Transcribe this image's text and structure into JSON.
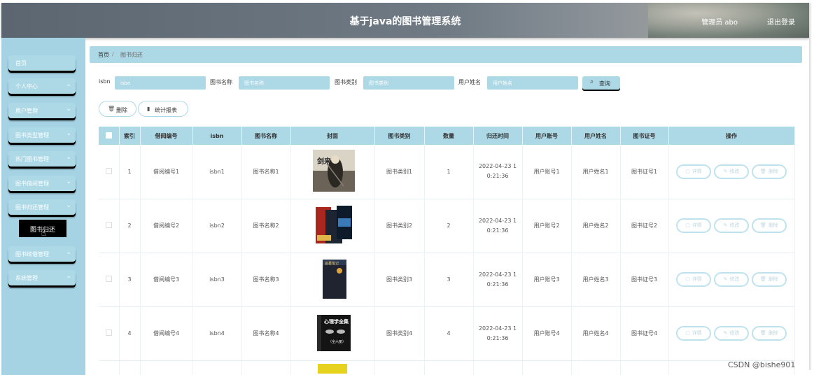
{
  "header": {
    "title": "基于java的图书管理系统",
    "admin_label": "管理员 abo",
    "logout": "退出登录"
  },
  "sidebar": {
    "items": [
      {
        "label": "首页",
        "has_chevron": false
      },
      {
        "label": "个人中心",
        "has_chevron": true
      },
      {
        "label": "用户管理",
        "has_chevron": true
      },
      {
        "label": "图书类型管理",
        "has_chevron": true
      },
      {
        "label": "热门图书管理",
        "has_chevron": true
      },
      {
        "label": "图书借阅管理",
        "has_chevron": true
      },
      {
        "label": "图书归还管理",
        "has_chevron": true
      },
      {
        "label": "图书续借管理",
        "has_chevron": true
      },
      {
        "label": "系统管理",
        "has_chevron": true
      }
    ],
    "open_submenu_item": "图书归还"
  },
  "breadcrumb": {
    "home": "首页",
    "separator": "/",
    "current": "图书归还"
  },
  "search": {
    "fields": [
      {
        "label": "isbn",
        "placeholder": "isbn"
      },
      {
        "label": "图书名称",
        "placeholder": "图书名称"
      },
      {
        "label": "图书类别",
        "placeholder": "图书类别"
      },
      {
        "label": "用户姓名",
        "placeholder": "用户姓名"
      }
    ],
    "button_label": "查询",
    "button_icon": "search-icon"
  },
  "actions": {
    "delete_label": "删除",
    "delete_icon": "trash-icon",
    "report_label": "统计报表",
    "report_icon": "bar-chart-icon"
  },
  "table": {
    "columns": [
      "",
      "索引",
      "借阅编号",
      "isbn",
      "图书名称",
      "封面",
      "图书类别",
      "数量",
      "归还时间",
      "用户账号",
      "用户姓名",
      "图书证号",
      "操作"
    ],
    "rows": [
      {
        "index": "1",
        "borrow_no": "借阅编号1",
        "isbn": "isbn1",
        "book_name": "图书名称1",
        "category": "图书类别1",
        "quantity": "1",
        "return_time_line1": "2022-04-23 1",
        "return_time_line2": "0:21:36",
        "account": "用户账号1",
        "user_name": "用户姓名1",
        "card_no": "图书证号1"
      },
      {
        "index": "2",
        "borrow_no": "借阅编号2",
        "isbn": "isbn2",
        "book_name": "图书名称2",
        "category": "图书类别2",
        "quantity": "2",
        "return_time_line1": "2022-04-23 1",
        "return_time_line2": "0:21:36",
        "account": "用户账号2",
        "user_name": "用户姓名2",
        "card_no": "图书证号2"
      },
      {
        "index": "3",
        "borrow_no": "借阅编号3",
        "isbn": "isbn3",
        "book_name": "图书名称3",
        "category": "图书类别3",
        "quantity": "3",
        "return_time_line1": "2022-04-23 1",
        "return_time_line2": "0:21:36",
        "account": "用户账号3",
        "user_name": "用户姓名3",
        "card_no": "图书证号3"
      },
      {
        "index": "4",
        "borrow_no": "借阅编号4",
        "isbn": "isbn4",
        "book_name": "图书名称4",
        "category": "图书类别4",
        "quantity": "4",
        "return_time_line1": "2022-04-23 1",
        "return_time_line2": "0:21:36",
        "account": "用户账号4",
        "user_name": "用户姓名4",
        "card_no": "图书证号4"
      }
    ],
    "row_actions": {
      "detail": "详情",
      "edit": "修改",
      "delete": "删除"
    }
  },
  "covers": [
    {
      "title_text": "剑来"
    },
    {
      "title_text": ""
    },
    {
      "title_text": "盗墓笔记"
    },
    {
      "title_text": "心理学全集",
      "subtitle_text": "（全六册）"
    }
  ],
  "watermark": "CSDN @bishe901",
  "colors": {
    "accent": "#add8e6",
    "sidebar": "#a5d3e4",
    "header": "#66717b"
  }
}
